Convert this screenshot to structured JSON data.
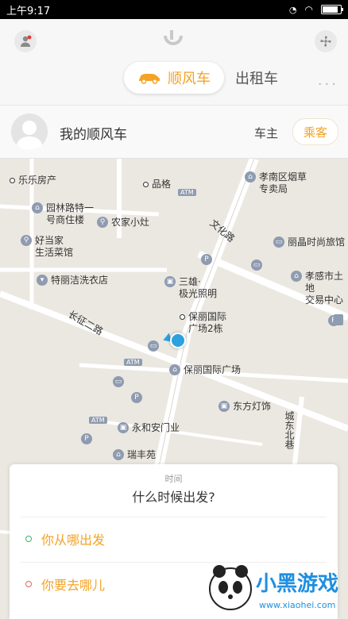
{
  "status_bar": {
    "time": "上午9:17"
  },
  "header": {
    "tabs": [
      {
        "label": "顺风车",
        "active": true
      },
      {
        "label": "出租车",
        "active": false
      }
    ],
    "more": "···"
  },
  "profile": {
    "title": "我的顺风车",
    "driver_tab": "车主",
    "passenger_tab": "乘客"
  },
  "map": {
    "pois": [
      "乐乐房产",
      "品格",
      "孝南区烟草",
      "专卖局",
      "园林路特一",
      "号商住楼",
      "农家小灶",
      "丽晶时尚旅馆",
      "好当家",
      "生活菜馆",
      "孝感市土地",
      "交易中心",
      "特丽洁洗衣店",
      "三雄·",
      "极光照明",
      "保丽国际",
      "广场2栋",
      "保丽国际广场",
      "东方灯饰",
      "永和安门业",
      "瑞丰苑"
    ],
    "roads": [
      "文化路",
      "长征二路",
      "城东北巷"
    ],
    "atm_label": "ATM",
    "parking_label": "P"
  },
  "card": {
    "time_label": "时间",
    "time_prompt": "什么时候出发?",
    "from": "你从哪出发",
    "to": "你要去哪儿"
  },
  "watermark": {
    "brand": "小黑游戏",
    "url": "www.xiaohei.com"
  },
  "colors": {
    "accent": "#f4a324",
    "from_ring": "#3cb371",
    "to_ring": "#e06666",
    "location": "#2ba1e0"
  }
}
